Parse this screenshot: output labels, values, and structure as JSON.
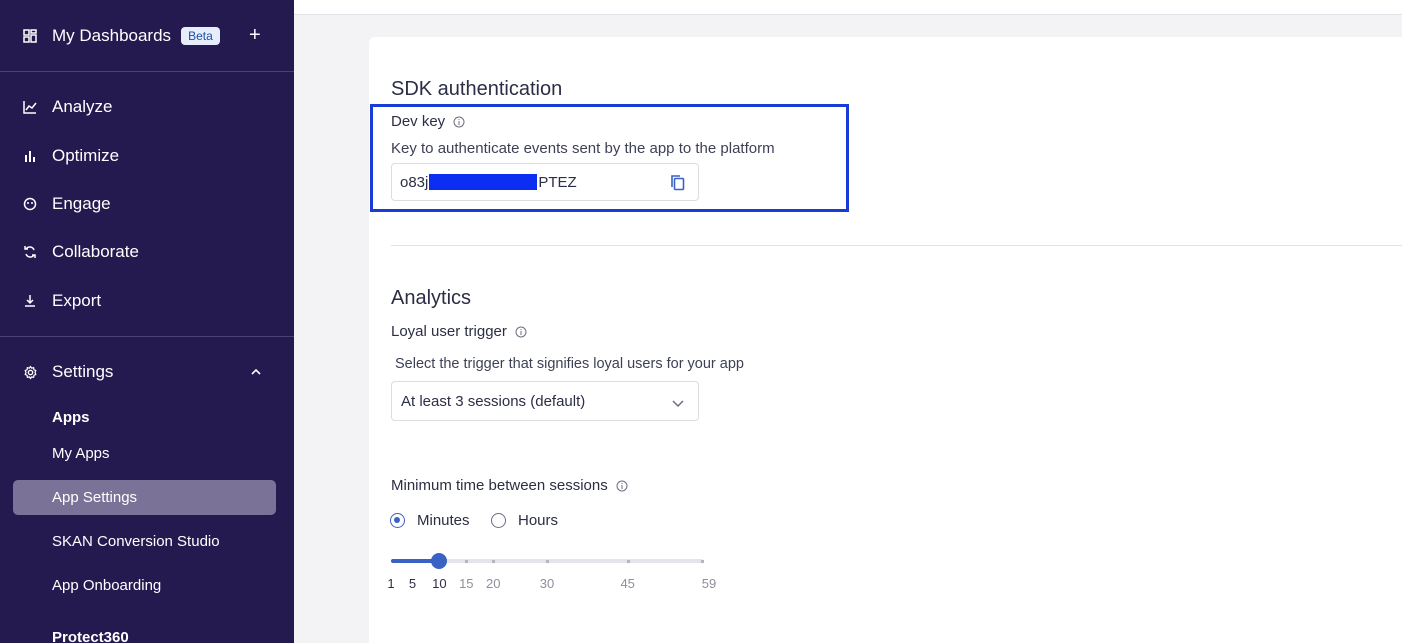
{
  "sidebar": {
    "dashboards_label": "My Dashboards",
    "beta_badge": "Beta",
    "add_label": "+",
    "nav": [
      {
        "label": "Analyze",
        "icon": "analyze-icon"
      },
      {
        "label": "Optimize",
        "icon": "bar-chart-icon"
      },
      {
        "label": "Engage",
        "icon": "engage-icon"
      },
      {
        "label": "Collaborate",
        "icon": "sync-icon"
      },
      {
        "label": "Export",
        "icon": "download-icon"
      }
    ],
    "settings_label": "Settings",
    "apps_heading": "Apps",
    "sub_items": [
      "My Apps",
      "App Settings",
      "SKAN Conversion Studio",
      "App Onboarding"
    ],
    "active_sub_item": "App Settings",
    "protect_heading": "Protect360"
  },
  "sdk": {
    "title": "SDK authentication",
    "dev_key_label": "Dev key",
    "dev_key_desc": "Key to authenticate events sent by the app to the platform",
    "key_prefix": "o83j",
    "key_suffix": "PTEZ"
  },
  "analytics": {
    "title": "Analytics",
    "loyal_label": "Loyal user trigger",
    "loyal_desc": "Select the trigger that signifies loyal users for your app",
    "loyal_value": "At least 3 sessions (default)",
    "min_time_label": "Minimum time between sessions",
    "radio_minutes": "Minutes",
    "radio_hours": "Hours",
    "selected_unit": "Minutes",
    "slider": {
      "min": 1,
      "max": 59,
      "value": 10,
      "marks": [
        "1",
        "5",
        "10",
        "15",
        "20",
        "30",
        "45",
        "59"
      ]
    }
  },
  "colors": {
    "sidebar_bg": "#251a4f",
    "accent": "#3a61c4",
    "highlight_border": "#1a3cd6"
  }
}
